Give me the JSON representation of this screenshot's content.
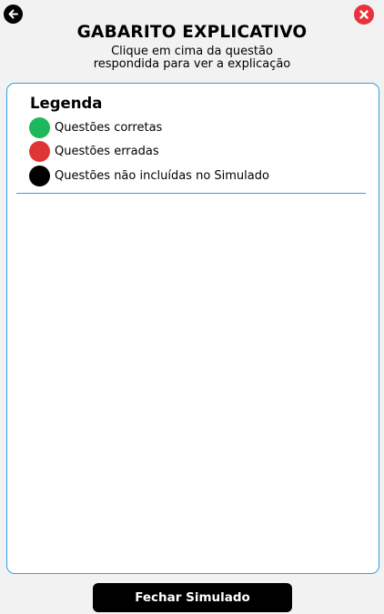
{
  "header": {
    "title": "GABARITO EXPLICATIVO",
    "subtitle_line1": "Clique em cima da questão",
    "subtitle_line2": "respondida para ver a explicação",
    "back_icon": "arrow-left-icon",
    "close_icon": "close-icon"
  },
  "legend": {
    "title": "Legenda",
    "items": [
      {
        "label": "Questões corretas",
        "color": "#1cb85c"
      },
      {
        "label": "Questões erradas",
        "color": "#e03535"
      },
      {
        "label": "Questões não incluídas no Simulado",
        "color": "#000000"
      }
    ]
  },
  "footer": {
    "button_label": "Fechar Simulado"
  },
  "colors": {
    "accent": "#2f9fe3",
    "close": "#e8323c",
    "background": "#f2f2f2"
  }
}
